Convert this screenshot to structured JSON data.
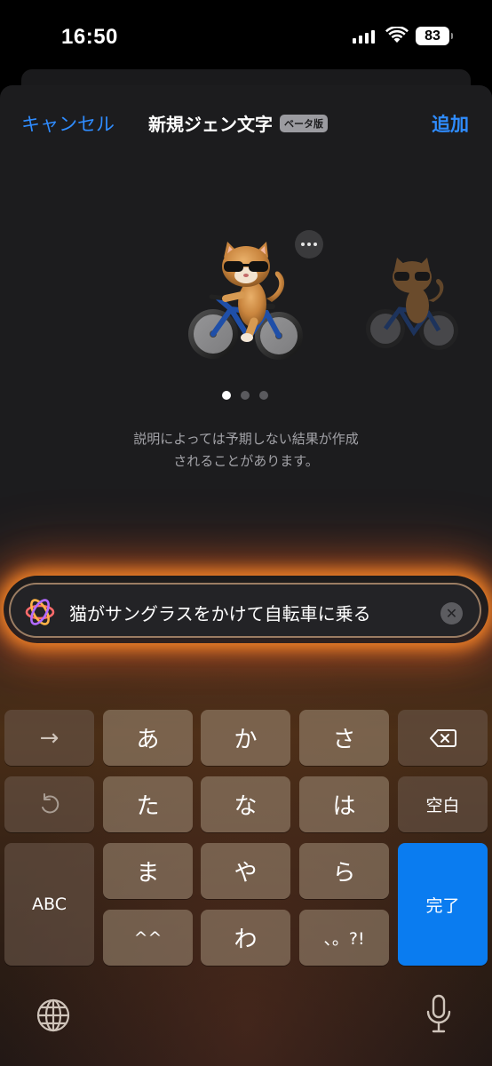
{
  "status_bar": {
    "time": "16:50",
    "battery": "83"
  },
  "header": {
    "cancel_label": "キャンセル",
    "title": "新規ジェン文字",
    "beta_badge": "ベータ版",
    "add_label": "追加"
  },
  "carousel": {
    "page_count": 3,
    "active_index": 0
  },
  "notice": {
    "line1": "説明によっては予期しない結果が作成",
    "line2": "されることがあります。"
  },
  "prompt": {
    "text": "猫がサングラスをかけて自転車に乗る",
    "clear_icon": "xmark-circle-icon"
  },
  "keyboard": {
    "row1": [
      "→",
      "あ",
      "か",
      "さ"
    ],
    "row2": [
      "た",
      "な",
      "は",
      "空白"
    ],
    "row3": [
      "ABC",
      "ま",
      "や",
      "ら",
      "完了"
    ],
    "row4": [
      "^^",
      "わ",
      "、。?!"
    ],
    "icons": [
      "backspace-icon",
      "undo-icon",
      "globe-icon",
      "microphone-icon"
    ]
  },
  "colors": {
    "accent": "#2F8CFF",
    "done_key": "#0A7CF0",
    "glow": "#FF8C28"
  }
}
